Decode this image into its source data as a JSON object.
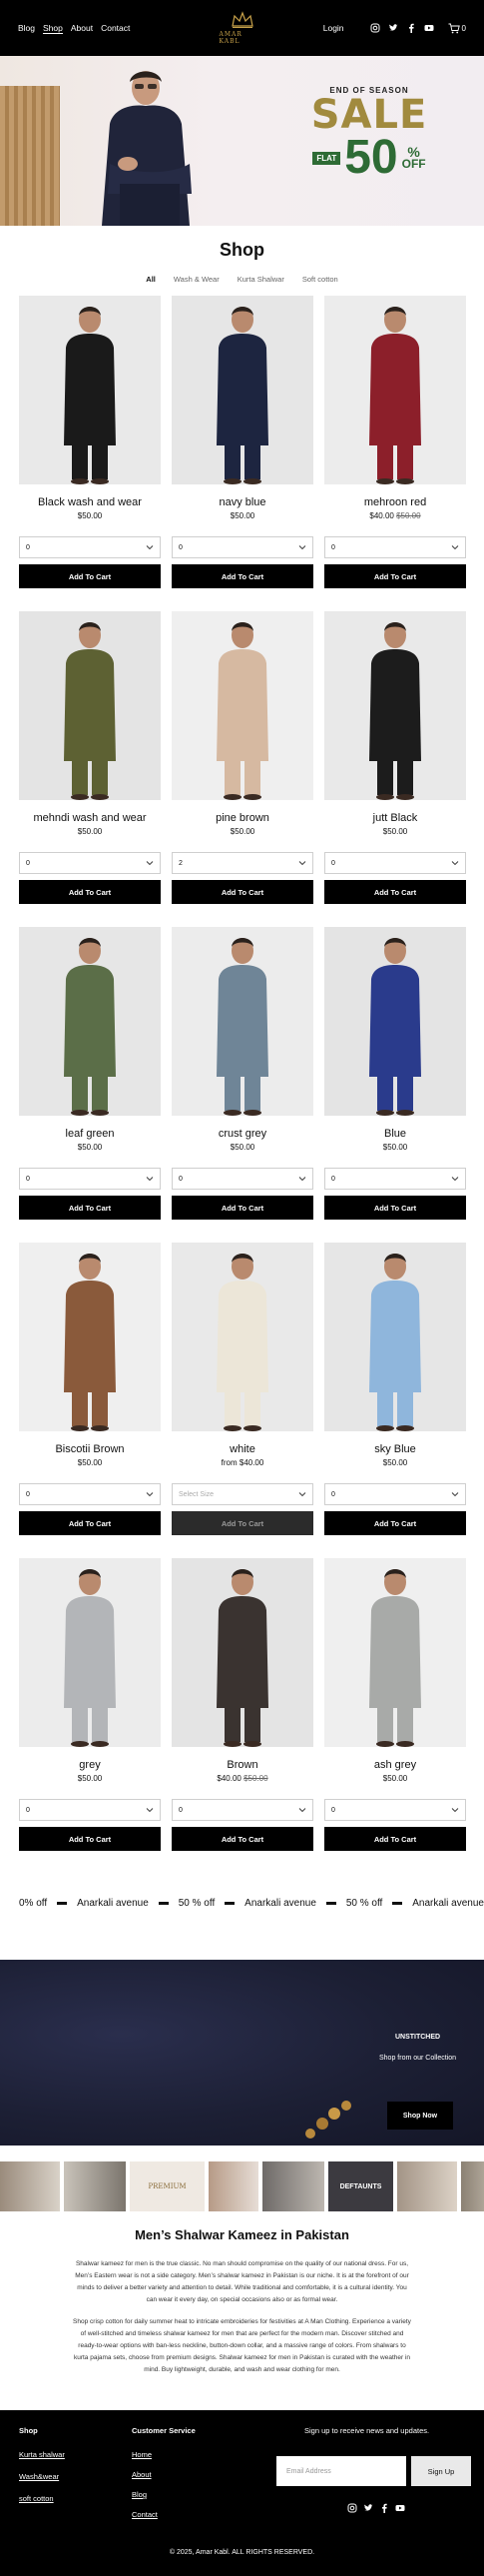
{
  "nav": {
    "links": [
      "Blog",
      "Shop",
      "About",
      "Contact"
    ],
    "active": "Shop",
    "brand_name": "AMAR KABL",
    "login_label": "Login",
    "cart_count": "0",
    "social_icons": [
      "instagram-icon",
      "twitter-icon",
      "facebook-icon",
      "youtube-icon"
    ]
  },
  "hero": {
    "kicker": "END OF SEASON",
    "headline": "SALE",
    "flat_label": "FLAT",
    "percent": "50",
    "percent_sign": "%",
    "off": "OFF",
    "colors": {
      "gold": "#a18a3e",
      "green": "#2e6b35"
    }
  },
  "shop": {
    "title": "Shop",
    "filters": [
      "All",
      "Wash & Wear",
      "Kurta Shalwar",
      "Soft cotton"
    ],
    "active_filter": "All",
    "add_label": "Add To Cart",
    "products": [
      {
        "name": "Black wash and wear",
        "price": "$50.00",
        "old_price": "",
        "qty": "0",
        "color": "#1a1a1a"
      },
      {
        "name": "navy blue",
        "price": "$50.00",
        "old_price": "",
        "qty": "0",
        "color": "#1d2540"
      },
      {
        "name": "mehroon red",
        "price": "$40.00",
        "old_price": "$50.00",
        "qty": "0",
        "color": "#8c1f2a"
      },
      {
        "name": "mehndi wash and wear",
        "price": "$50.00",
        "old_price": "",
        "qty": "0",
        "color": "#5d6133"
      },
      {
        "name": "pine brown",
        "price": "$50.00",
        "old_price": "",
        "qty": "2",
        "color": "#d6b9a1"
      },
      {
        "name": "jutt Black",
        "price": "$50.00",
        "old_price": "",
        "qty": "0",
        "color": "#1c1c1c"
      },
      {
        "name": "leaf green",
        "price": "$50.00",
        "old_price": "",
        "qty": "0",
        "color": "#5b6e48"
      },
      {
        "name": "crust grey",
        "price": "$50.00",
        "old_price": "",
        "qty": "0",
        "color": "#6f8597"
      },
      {
        "name": "Blue",
        "price": "$50.00",
        "old_price": "",
        "qty": "0",
        "color": "#2a3b8c"
      },
      {
        "name": "Biscotii Brown",
        "price": "$50.00",
        "old_price": "",
        "qty": "0",
        "color": "#8a5a3b"
      },
      {
        "name": "white",
        "price": "from $40.00",
        "old_price": "",
        "qty": "Select Size",
        "color": "#ece6d8"
      },
      {
        "name": "sky Blue",
        "price": "$50.00",
        "old_price": "",
        "qty": "0",
        "color": "#8fb6dc"
      },
      {
        "name": "grey",
        "price": "$50.00",
        "old_price": "",
        "qty": "0",
        "color": "#b3b5b8"
      },
      {
        "name": "Brown",
        "price": "$40.00",
        "old_price": "$50.00",
        "qty": "0",
        "color": "#3a3330"
      },
      {
        "name": "ash grey",
        "price": "$50.00",
        "old_price": "",
        "qty": "0",
        "color": "#a8aaa8"
      }
    ]
  },
  "marquee": [
    "0% off",
    "Anarkali avenue",
    "50 % off",
    "Anarkali avenue",
    "50 % off",
    "Anarkali avenue"
  ],
  "banner": {
    "eyebrow": "UNSTITCHED",
    "subtitle": "Shop from our Collection",
    "cta": "Shop Now"
  },
  "strip_labels": [
    "PREMIUM",
    "DEFTAUNTS"
  ],
  "seo": {
    "title": "Men’s Shalwar Kameez in Pakistan",
    "p1": "Shalwar kameez for men is the true classic. No man should compromise on the quality of our national dress. For us, Men’s Eastern wear is not a side category. Men’s shalwar kameez in Pakistan is our niche. It is at the forefront of our minds to deliver a better variety and attention to detail. While traditional and comfortable, it is a cultural identity. You can wear it every day, on special occasions also or as formal wear.",
    "p2": "Shop crisp cotton for daily summer heat to intricate embroideries for festivities at A Man Clothing. Experience a variety of well-stitched and timeless shalwar kameez for men that are perfect for the modern man. Discover stitched and ready-to-wear options with ban-less neckline, button-down collar, and a massive range of colors. From shalwars to kurta pajama sets, choose from premium designs. Shalwar kameez for men in Pakistan is curated with the weather in mind. Buy lightweight, durable, and wash and wear clothing for men."
  },
  "footer": {
    "shop_heading": "Shop",
    "shop_links": [
      "Kurta shalwar",
      "Wash&wear",
      "soft cotton"
    ],
    "service_heading": "Customer Service",
    "service_links": [
      "Home",
      "About",
      "Blog",
      "Contact"
    ],
    "signup": "Sign up to receive news and updates.",
    "email_placeholder": "Email Address",
    "signup_button": "Sign Up",
    "copyright": "© 2025, Amar Kabl. ALL RIGHTS RESERVED."
  }
}
